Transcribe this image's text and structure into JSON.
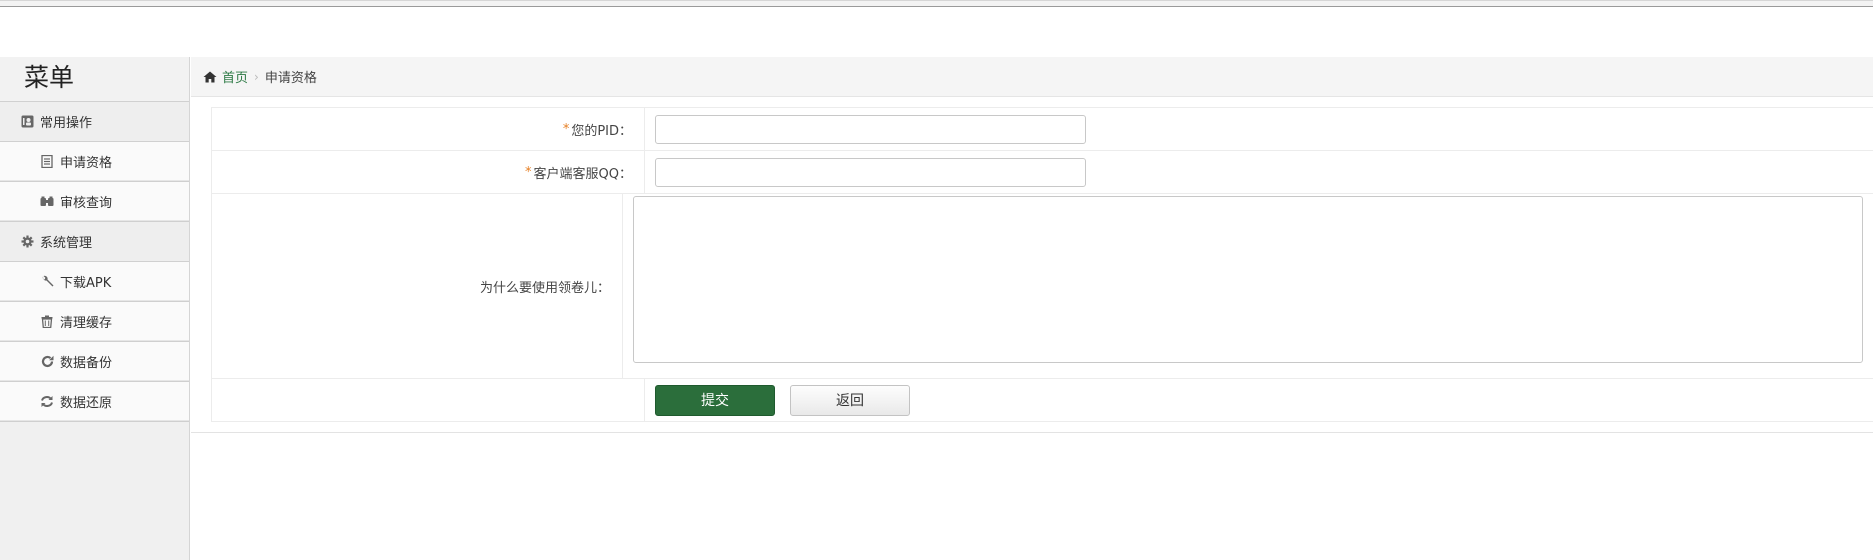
{
  "sidebar": {
    "title": "菜单",
    "groups": [
      {
        "label": "常用操作",
        "icon": "user-card-icon",
        "items": [
          {
            "label": "申请资格",
            "icon": "document-icon"
          },
          {
            "label": "审核查询",
            "icon": "binoculars-icon"
          }
        ]
      },
      {
        "label": "系统管理",
        "icon": "gear-icon",
        "items": [
          {
            "label": "下载APK",
            "icon": "wrench-icon"
          },
          {
            "label": "清理缓存",
            "icon": "trash-icon"
          },
          {
            "label": "数据备份",
            "icon": "refresh-icon"
          },
          {
            "label": "数据还原",
            "icon": "sync-icon"
          }
        ]
      }
    ]
  },
  "breadcrumb": {
    "home": "首页",
    "current": "申请资格"
  },
  "form": {
    "required_mark": "*",
    "pid_label": "您的PID：",
    "pid_value": "",
    "qq_label": "客户端客服QQ：",
    "qq_value": "",
    "reason_label": "为什么要使用领卷儿：",
    "reason_value": "",
    "submit_label": "提交",
    "back_label": "返回"
  },
  "colors": {
    "primary": "#2b6e3b",
    "required": "#e67e22",
    "breadcrumb_link": "#2d7a45"
  }
}
